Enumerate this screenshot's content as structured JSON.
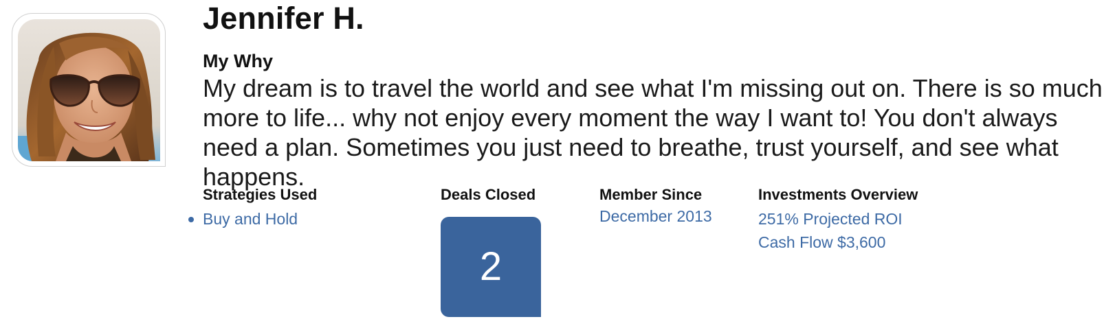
{
  "profile": {
    "name": "Jennifer H.",
    "avatar_icon": "user-photo"
  },
  "why": {
    "heading": "My Why",
    "text": "My dream is to travel the world and see what I'm missing out on. There is so much more to life... why not enjoy every moment the way I want to! You don't always need a plan. Sometimes you just need to breathe, trust yourself, and see what happens."
  },
  "stats": {
    "strategies": {
      "label": "Strategies Used",
      "items": [
        "Buy and Hold"
      ]
    },
    "deals": {
      "label": "Deals Closed",
      "count": "2"
    },
    "member": {
      "label": "Member Since",
      "value": "December 2013"
    },
    "investments": {
      "label": "Investments Overview",
      "roi": "251% Projected ROI",
      "cash_flow": "Cash Flow $3,600"
    }
  },
  "colors": {
    "accent": "#3d6aa5",
    "deals_box": "#3a649c"
  }
}
